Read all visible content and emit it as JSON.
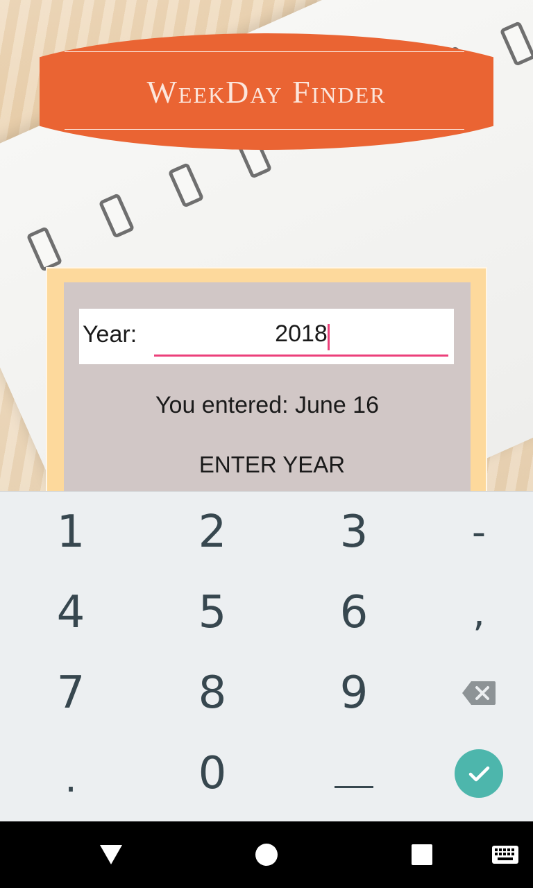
{
  "app": {
    "title": "WeekDay Finder"
  },
  "form": {
    "year_label": "Year:",
    "year_value": "2018",
    "entered_text": "You entered: June 16",
    "enter_button_label": "ENTER YEAR"
  },
  "keyboard": {
    "rows": [
      [
        "1",
        "2",
        "3",
        "-"
      ],
      [
        "4",
        "5",
        "6",
        ","
      ],
      [
        "7",
        "8",
        "9",
        "backspace-icon"
      ],
      [
        ".",
        "0",
        "space-bar",
        "check-icon"
      ]
    ],
    "keys": {
      "k1": "1",
      "k2": "2",
      "k3": "3",
      "dash": "-",
      "k4": "4",
      "k5": "5",
      "k6": "6",
      "comma": ",",
      "k7": "7",
      "k8": "8",
      "k9": "9",
      "period": ".",
      "k0": "0"
    },
    "accent_color": "#4db6ac"
  },
  "colors": {
    "banner": "#ea6433",
    "card_border": "#fdd99c",
    "card_fill": "#d1c7c6",
    "input_underline": "#ec407a"
  },
  "navbar": {
    "icons": [
      "back-icon",
      "home-icon",
      "recents-icon",
      "keyboard-switch-icon"
    ]
  }
}
